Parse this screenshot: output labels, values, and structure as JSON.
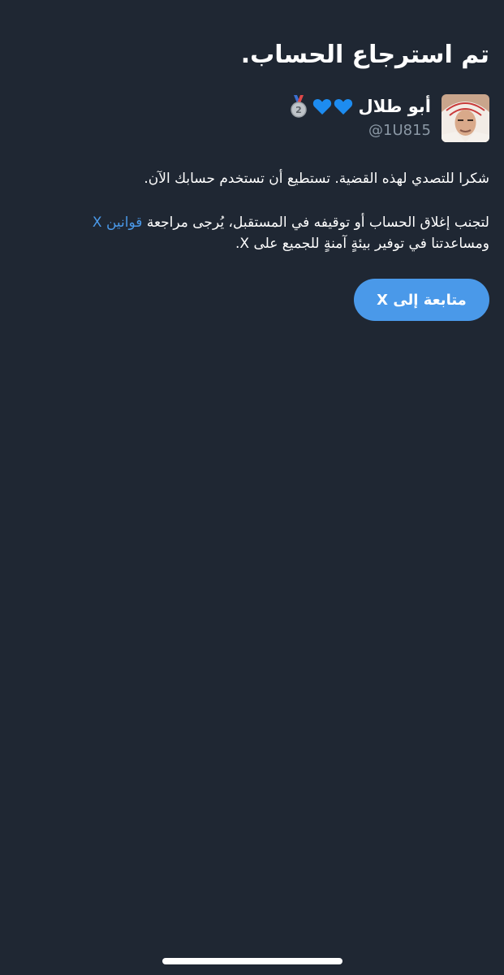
{
  "header": {
    "title": "تم استرجاع الحساب."
  },
  "user": {
    "display_name": "أبو طلال",
    "handle": "@1U815",
    "badges": [
      "blue-heart-icon",
      "blue-heart-icon",
      "second-place-medal-icon"
    ],
    "medal_number": "2"
  },
  "message": {
    "paragraph1": "شكرا للتصدي لهذه القضية. تستطيع أن تستخدم حسابك الآن.",
    "paragraph2_before_link": "لتجنب إغلاق الحساب أو توقيفه في المستقبل، يُرجى مراجعة",
    "rules_link": "قوانين X",
    "paragraph2_after_link": "ومساعدتنا في توفير بيئةٍ آمنةٍ للجميع على X."
  },
  "actions": {
    "continue_label": "متابعة إلى X"
  },
  "colors": {
    "background": "#1f2733",
    "accent": "#4a99e9",
    "secondary_text": "#8b98a5"
  }
}
